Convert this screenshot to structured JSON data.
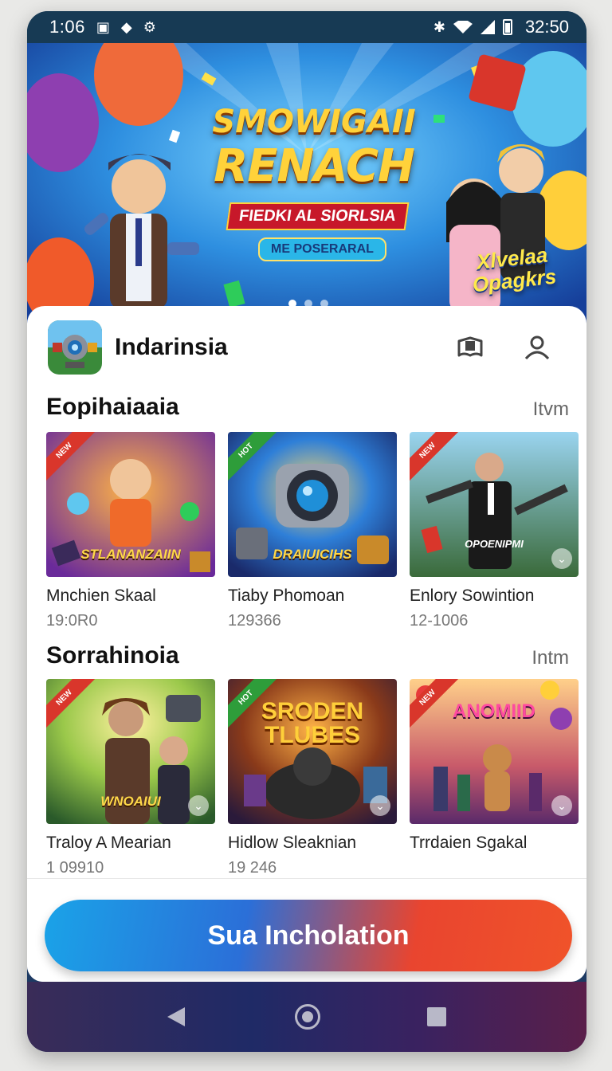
{
  "status_bar": {
    "time": "1:06",
    "clock": "32:50",
    "icons": [
      "photo-icon",
      "app-icon",
      "settings-icon",
      "bluetooth-icon",
      "wifi-icon",
      "signal-icon",
      "battery-icon"
    ]
  },
  "hero": {
    "title_line1": "SMOWIGAII",
    "title_line2": "RENACH",
    "subtitle": "FIEDKI AL SIORLSIA",
    "tag": "ME POSERARAL",
    "side_text": "Xlvelaa Opagkrs",
    "slide_count": 3,
    "active_slide": 1
  },
  "app": {
    "name": "Indarinsia"
  },
  "sections": [
    {
      "title": "Eopihaiaaia",
      "link": "Itvm",
      "items": [
        {
          "title": "Mnchien Skaal",
          "meta": "19:0R0",
          "caption": "STLANANZAIIN",
          "ribbon": "NEW",
          "ribbon_color": "#d9362b"
        },
        {
          "title": "Tiaby Phomoan",
          "meta": "129366",
          "caption": "DRAIUICIHS",
          "ribbon": "HOT",
          "ribbon_color": "#2e9d3a"
        },
        {
          "title": "Enlory Sowintion",
          "meta": "12-1006",
          "caption": "OPOENIPMI",
          "ribbon": "NEW",
          "ribbon_color": "#d9362b"
        }
      ]
    },
    {
      "title": "Sorrahinoia",
      "link": "Intm",
      "items": [
        {
          "title": "Traloy A Mearian",
          "meta": "1 09910",
          "caption": "WNOAIUI",
          "ribbon": "NEW",
          "ribbon_color": "#d9362b"
        },
        {
          "title": "Hidlow Sleaknian",
          "meta": "19 246",
          "caption": "SRODEN TLUBES",
          "ribbon": "HOT",
          "ribbon_color": "#2e9d3a"
        },
        {
          "title": "Trrdaien Sgakal",
          "meta": "",
          "caption": "ANOMIID",
          "ribbon": "NEW",
          "ribbon_color": "#d9362b"
        }
      ]
    }
  ],
  "install_button": {
    "label": "Sua Incholation"
  },
  "colors": {
    "status_bar": "#173a54",
    "accent_blue": "#1aa3e8",
    "accent_red": "#f0532a"
  }
}
